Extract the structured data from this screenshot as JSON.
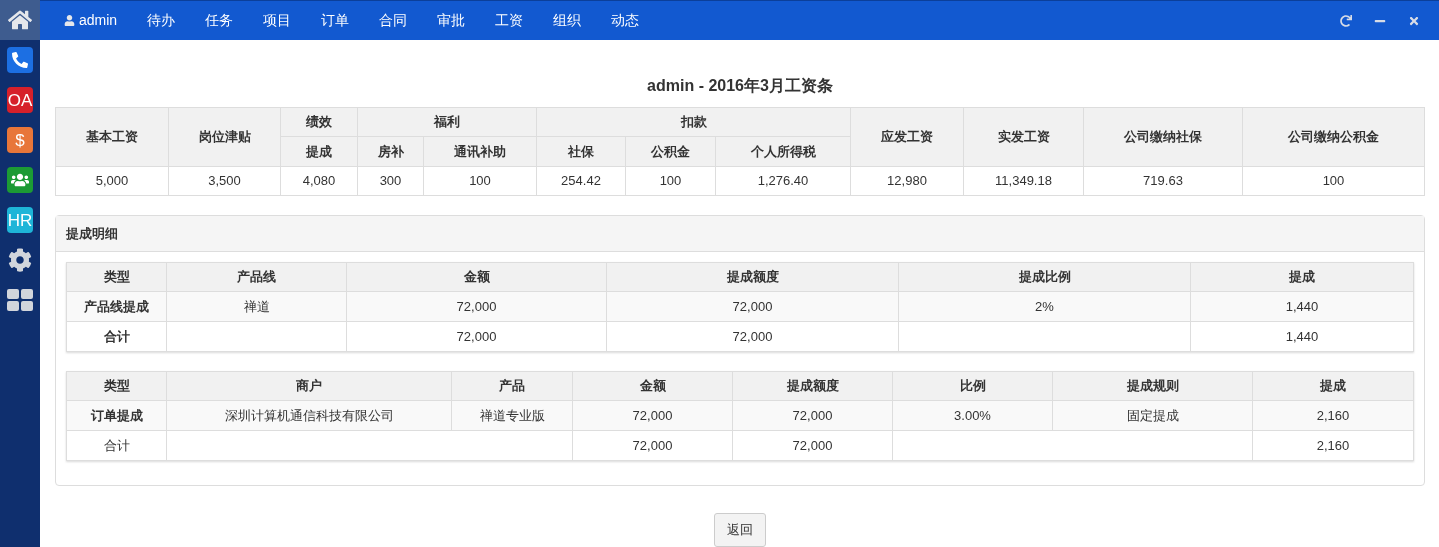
{
  "sidebar": {
    "items": [
      {
        "kind": "home",
        "selected": true
      },
      {
        "kind": "phone",
        "color": "#1c6fe3",
        "selected": false
      },
      {
        "kind": "text",
        "text": "OA",
        "color": "#d6202a",
        "selected": false
      },
      {
        "kind": "text",
        "text": "$",
        "color": "#e8763a",
        "selected": false
      },
      {
        "kind": "people",
        "color": "#1c9a34",
        "selected": false
      },
      {
        "kind": "text",
        "text": "HR",
        "color": "#1eb5d8",
        "selected": false
      },
      {
        "kind": "gear",
        "selected": false
      },
      {
        "kind": "grid",
        "selected": false
      }
    ]
  },
  "top_nav": {
    "user": "admin",
    "items": [
      "待办",
      "任务",
      "项目",
      "订单",
      "合同",
      "审批",
      "工资",
      "组织",
      "动态"
    ],
    "controls": [
      {
        "kind": "refresh"
      },
      {
        "kind": "minimize"
      },
      {
        "kind": "close"
      }
    ]
  },
  "payslip": {
    "title": "admin - 2016年3月工资条",
    "header": [
      {
        "label": "基本工资"
      },
      {
        "label": "岗位津贴"
      },
      {
        "label": "绩效",
        "children": [
          "提成"
        ]
      },
      {
        "label": "福利",
        "children": [
          "房补",
          "通讯补助"
        ]
      },
      {
        "label": "扣款",
        "children": [
          "社保",
          "公积金",
          "个人所得税"
        ]
      },
      {
        "label": "应发工资"
      },
      {
        "label": "实发工资"
      },
      {
        "label": "公司缴纳社保"
      },
      {
        "label": "公司缴纳公积金"
      }
    ],
    "values": [
      "5,000",
      "3,500",
      "4,080",
      "300",
      "100",
      "254.42",
      "100",
      "1,276.40",
      "12,980",
      "11,349.18",
      "719.63",
      "100"
    ]
  },
  "commission_panel": {
    "title": "提成明细",
    "tables": [
      {
        "columns": [
          "类型",
          "产品线",
          "金额",
          "提成额度",
          "提成比例",
          "提成"
        ],
        "rows": [
          {
            "label_bold": true,
            "cells": [
              {
                "kind": "text",
                "text": "产品线提成"
              },
              {
                "kind": "text",
                "text": "禅道"
              },
              {
                "kind": "text",
                "text": "72,000"
              },
              {
                "kind": "text",
                "text": "72,000"
              },
              {
                "kind": "text",
                "text": "2%"
              },
              {
                "kind": "text",
                "text": "1,440"
              }
            ]
          },
          {
            "label_bold": true,
            "cells": [
              {
                "kind": "text",
                "text": "合计"
              },
              {
                "kind": "text",
                "text": ""
              },
              {
                "kind": "text",
                "text": "72,000"
              },
              {
                "kind": "text",
                "text": "72,000"
              },
              {
                "kind": "text",
                "text": ""
              },
              {
                "kind": "text",
                "text": "1,440"
              }
            ]
          }
        ]
      },
      {
        "columns": [
          "类型",
          "商户",
          "产品",
          "金额",
          "提成额度",
          "比例",
          "提成规则",
          "提成"
        ],
        "rows": [
          {
            "label_bold": true,
            "cells": [
              {
                "kind": "text",
                "text": "订单提成"
              },
              {
                "kind": "text",
                "text": "深圳计算机通信科技有限公司"
              },
              {
                "kind": "text",
                "text": "禅道专业版"
              },
              {
                "kind": "text",
                "text": "72,000"
              },
              {
                "kind": "text",
                "text": "72,000"
              },
              {
                "kind": "text",
                "text": "3.00%"
              },
              {
                "kind": "text",
                "text": "固定提成"
              },
              {
                "kind": "text",
                "text": "2,160"
              }
            ]
          },
          {
            "label_bold": false,
            "cells": [
              {
                "kind": "text",
                "text": "合计"
              },
              {
                "kind": "text",
                "text": ""
              },
              {
                "kind": "merged"
              },
              {
                "kind": "text",
                "text": "72,000"
              },
              {
                "kind": "text",
                "text": "72,000"
              },
              {
                "kind": "text",
                "text": ""
              },
              {
                "kind": "merged"
              },
              {
                "kind": "text",
                "text": "2,160"
              }
            ]
          }
        ]
      }
    ]
  },
  "back_button": "返回"
}
